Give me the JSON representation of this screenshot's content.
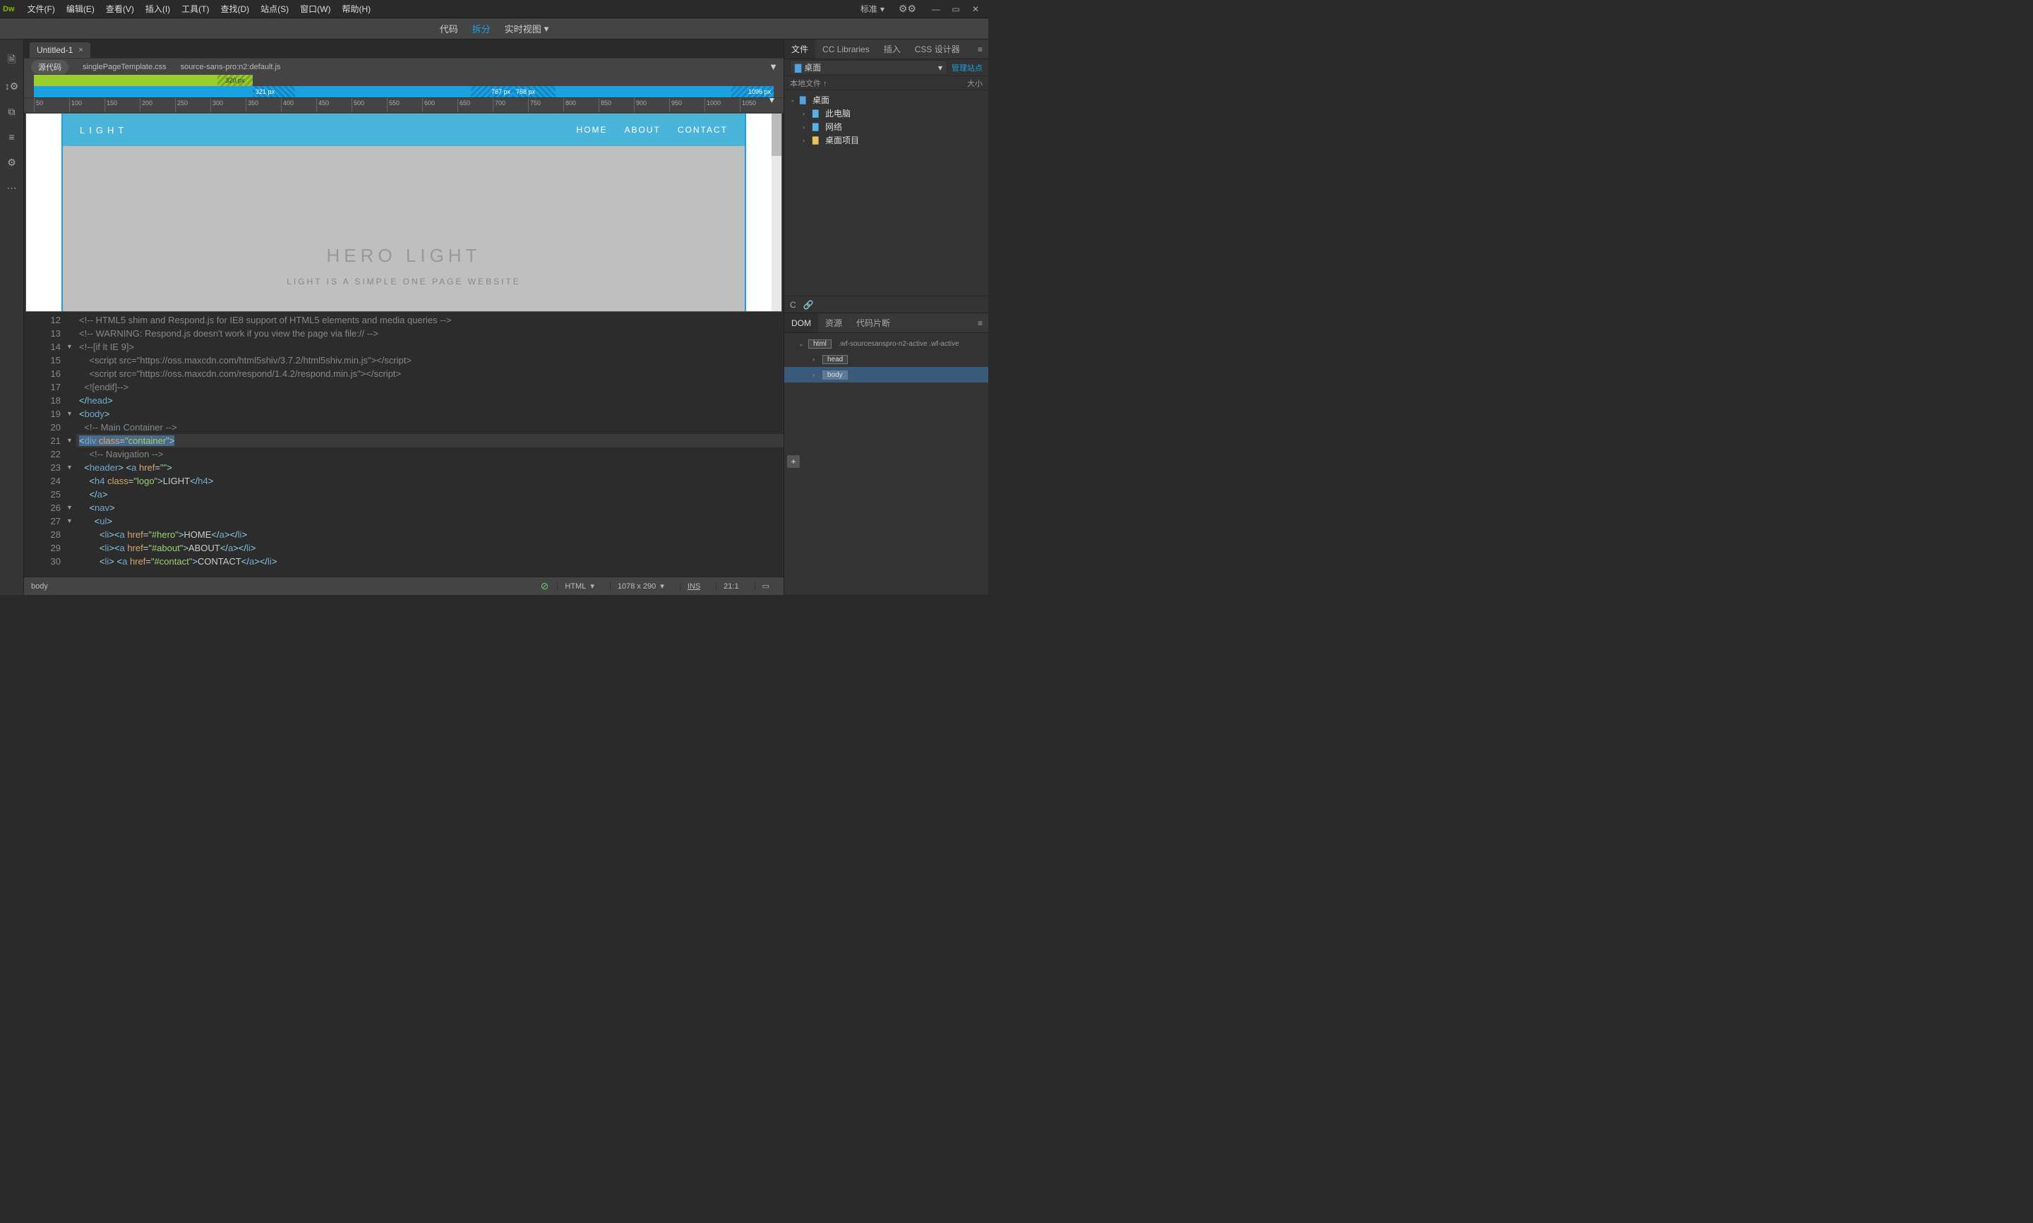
{
  "menubar": {
    "logo": "Dw",
    "items": [
      "文件(F)",
      "编辑(E)",
      "查看(V)",
      "插入(I)",
      "工具(T)",
      "查找(D)",
      "站点(S)",
      "窗口(W)",
      "帮助(H)"
    ],
    "workspace": "标准"
  },
  "viewSwitcher": {
    "code": "代码",
    "split": "拆分",
    "live": "实时视图"
  },
  "docTab": {
    "title": "Untitled-1"
  },
  "sourceBar": {
    "source": "源代码",
    "files": [
      "singlePageTemplate.css",
      "source-sans-pro:n2:default.js"
    ]
  },
  "breakpoints": {
    "green_end": "320 px",
    "blue_s1": "321 px",
    "blue_s2": "767 px",
    "blue_s3": "768 px",
    "blue_end": "1096 px"
  },
  "ruler": [
    "50",
    "100",
    "150",
    "200",
    "250",
    "300",
    "350",
    "400",
    "450",
    "500",
    "550",
    "600",
    "650",
    "700",
    "750",
    "800",
    "850",
    "900",
    "950",
    "1000",
    "1050"
  ],
  "preview": {
    "logo": "LIGHT",
    "nav": [
      "HOME",
      "ABOUT",
      "CONTACT"
    ],
    "hero1": "HERO",
    "hero2": " LIGHT",
    "tagline": "LIGHT IS A SIMPLE ONE PAGE WEBSITE"
  },
  "code": {
    "lines": [
      {
        "n": 12,
        "f": "",
        "html": "<span class='cm-comment'>&lt;!-- HTML5 shim and Respond.js for IE8 support of HTML5 elements and media queries --&gt;</span>"
      },
      {
        "n": 13,
        "f": "",
        "html": "<span class='cm-comment'>&lt;!-- WARNING: Respond.js doesn't work if you view the page via file:// --&gt;</span>"
      },
      {
        "n": 14,
        "f": "▼",
        "html": "<span class='cm-comment'>&lt;!--[if lt IE 9]&gt;</span>"
      },
      {
        "n": 15,
        "f": "",
        "html": "    <span class='cm-comment'>&lt;script src=\"https://oss.maxcdn.com/html5shiv/3.7.2/html5shiv.min.js\"&gt;&lt;/script&gt;</span>"
      },
      {
        "n": 16,
        "f": "",
        "html": "    <span class='cm-comment'>&lt;script src=\"https://oss.maxcdn.com/respond/1.4.2/respond.min.js\"&gt;&lt;/script&gt;</span>"
      },
      {
        "n": 17,
        "f": "",
        "html": "  <span class='cm-comment'>&lt;![endif]--&gt;</span>"
      },
      {
        "n": 18,
        "f": "",
        "html": "<span class='cm-bracket'>&lt;/</span><span class='cm-tag'>head</span><span class='cm-bracket'>&gt;</span>"
      },
      {
        "n": 19,
        "f": "▼",
        "html": "<span class='cm-bracket'>&lt;</span><span class='cm-tag'>body</span><span class='cm-bracket'>&gt;</span>"
      },
      {
        "n": 20,
        "f": "",
        "html": "  <span class='cm-comment'>&lt;!-- Main Container --&gt;</span>"
      },
      {
        "n": 21,
        "f": "▼",
        "html": "<span class='sel'><span class='cm-bracket'>&lt;</span><span class='cm-tag'>div</span> <span class='cm-attr'>class</span>=<span class='cm-string'>\"container\"</span><span class='cm-bracket'>&gt;</span></span>",
        "active": true
      },
      {
        "n": 22,
        "f": "",
        "html": "    <span class='cm-comment'>&lt;!-- Navigation --&gt;</span>"
      },
      {
        "n": 23,
        "f": "▼",
        "html": "  <span class='cm-bracket'>&lt;</span><span class='cm-tag'>header</span><span class='cm-bracket'>&gt;</span> <span class='cm-bracket'>&lt;</span><span class='cm-tag'>a</span> <span class='cm-attr'>href</span>=<span class='cm-string'>\"\"</span><span class='cm-bracket'>&gt;</span>"
      },
      {
        "n": 24,
        "f": "",
        "html": "    <span class='cm-bracket'>&lt;</span><span class='cm-tag'>h4</span> <span class='cm-attr'>class</span>=<span class='cm-string'>\"logo\"</span><span class='cm-bracket'>&gt;</span>LIGHT<span class='cm-bracket'>&lt;/</span><span class='cm-tag'>h4</span><span class='cm-bracket'>&gt;</span>"
      },
      {
        "n": 25,
        "f": "",
        "html": "    <span class='cm-bracket'>&lt;/</span><span class='cm-tag'>a</span><span class='cm-bracket'>&gt;</span>"
      },
      {
        "n": 26,
        "f": "▼",
        "html": "    <span class='cm-bracket'>&lt;</span><span class='cm-tag'>nav</span><span class='cm-bracket'>&gt;</span>"
      },
      {
        "n": 27,
        "f": "▼",
        "html": "      <span class='cm-bracket'>&lt;</span><span class='cm-tag'>ul</span><span class='cm-bracket'>&gt;</span>"
      },
      {
        "n": 28,
        "f": "",
        "html": "        <span class='cm-bracket'>&lt;</span><span class='cm-tag'>li</span><span class='cm-bracket'>&gt;&lt;</span><span class='cm-tag'>a</span> <span class='cm-attr'>href</span>=<span class='cm-string'>\"#hero\"</span><span class='cm-bracket'>&gt;</span>HOME<span class='cm-bracket'>&lt;/</span><span class='cm-tag'>a</span><span class='cm-bracket'>&gt;&lt;/</span><span class='cm-tag'>li</span><span class='cm-bracket'>&gt;</span>"
      },
      {
        "n": 29,
        "f": "",
        "html": "        <span class='cm-bracket'>&lt;</span><span class='cm-tag'>li</span><span class='cm-bracket'>&gt;&lt;</span><span class='cm-tag'>a</span> <span class='cm-attr'>href</span>=<span class='cm-string'>\"#about\"</span><span class='cm-bracket'>&gt;</span>ABOUT<span class='cm-bracket'>&lt;/</span><span class='cm-tag'>a</span><span class='cm-bracket'>&gt;&lt;/</span><span class='cm-tag'>li</span><span class='cm-bracket'>&gt;</span>"
      },
      {
        "n": 30,
        "f": "",
        "html": "        <span class='cm-bracket'>&lt;</span><span class='cm-tag'>li</span><span class='cm-bracket'>&gt;</span> <span class='cm-bracket'>&lt;</span><span class='cm-tag'>a</span> <span class='cm-attr'>href</span>=<span class='cm-string'>\"#contact\"</span><span class='cm-bracket'>&gt;</span>CONTACT<span class='cm-bracket'>&lt;/</span><span class='cm-tag'>a</span><span class='cm-bracket'>&gt;&lt;/</span><span class='cm-tag'>li</span><span class='cm-bracket'>&gt;</span>"
      }
    ]
  },
  "status": {
    "path": "body",
    "lang": "HTML",
    "dims": "1078 x 290",
    "mode": "INS",
    "cursor": "21:1"
  },
  "panels": {
    "topTabs": [
      "文件",
      "CC Libraries",
      "插入",
      "CSS 设计器"
    ],
    "siteSelector": "桌面",
    "manageSites": "管理站点",
    "localFiles": "本地文件 ↑",
    "sizeCol": "大小",
    "tree": [
      {
        "indent": 0,
        "chev": "⌄",
        "icon": "folder-blue",
        "label": "桌面"
      },
      {
        "indent": 1,
        "chev": "›",
        "icon": "computer-icon",
        "label": "此电脑"
      },
      {
        "indent": 1,
        "chev": "›",
        "icon": "network-icon",
        "label": "网络"
      },
      {
        "indent": 1,
        "chev": "›",
        "icon": "folder-yellow",
        "label": "桌面项目"
      }
    ],
    "domTabs": [
      "DOM",
      "资源",
      "代码片断"
    ],
    "dom": {
      "html_tag": "html",
      "html_classes": ".wf-sourcesanspro-n2-active .wf-active",
      "head": "head",
      "body": "body"
    }
  }
}
